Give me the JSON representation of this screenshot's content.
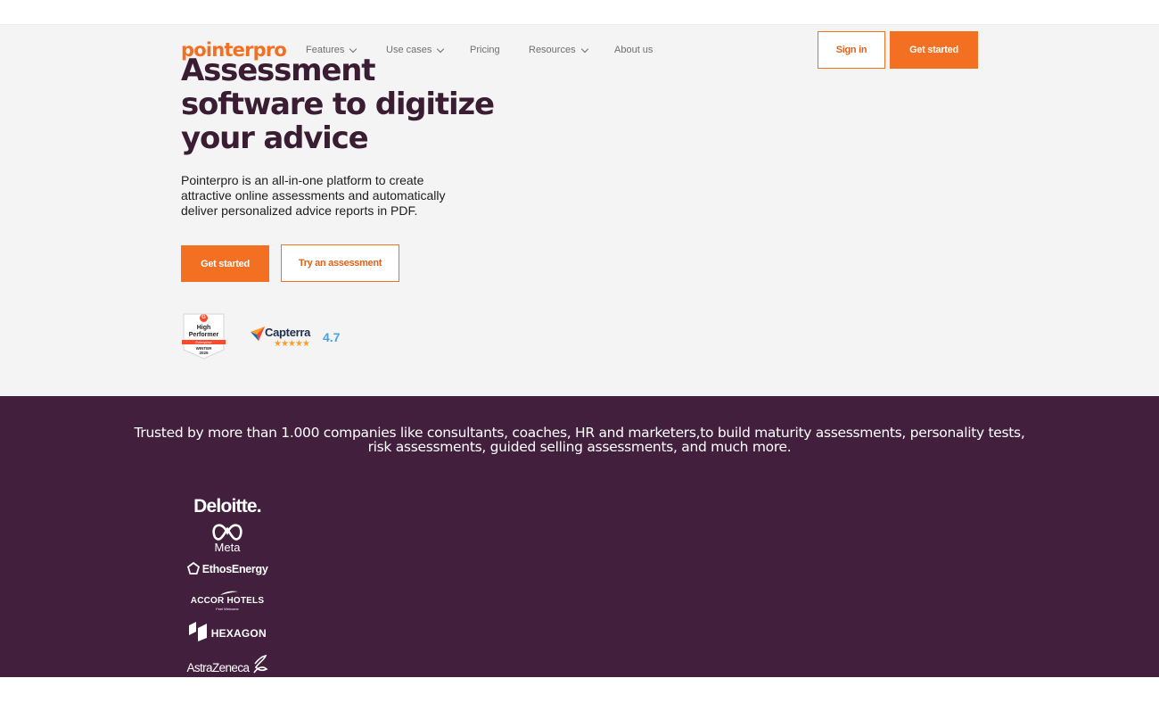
{
  "brand": {
    "name": "pointerpro",
    "primary_color": "#f36f21",
    "dark_color": "#3a1c33",
    "band_color": "#411f3d"
  },
  "nav": {
    "items": [
      {
        "label": "Features",
        "has_dropdown": true
      },
      {
        "label": "Use cases",
        "has_dropdown": true
      },
      {
        "label": "Pricing",
        "has_dropdown": false
      },
      {
        "label": "Resources",
        "has_dropdown": true
      },
      {
        "label": "About us",
        "has_dropdown": false
      }
    ],
    "sign_in_label": "Sign in",
    "get_started_label": "Get started"
  },
  "hero": {
    "title": "Assessment software to digitize your advice",
    "description": "Pointerpro is an all-in-one platform to create attractive online assessments and automatically deliver personalized advice reports in PDF.",
    "primary_cta": "Get started",
    "secondary_cta": "Try an assessment"
  },
  "badges": {
    "g2": {
      "mark": "G",
      "line1": "High",
      "line2": "Performer",
      "band": "Enterprise",
      "season": "WINTER",
      "year": "2025"
    },
    "capterra": {
      "name": "Capterra",
      "stars": "★★★★★",
      "score": "4.7"
    }
  },
  "trust": {
    "text": "Trusted by more than 1.000 companies like consultants, coaches, HR and marketers,to build maturity assessments, personality tests, risk assessments, guided selling assessments, and much more.",
    "logos": {
      "deloitte": "Deloitte.",
      "meta": "Meta",
      "ethos": "EthosEnergy",
      "accor": "ACCOR HOTELS",
      "accor_tagline": "Feel Welcome",
      "hexagon": "HEXAGON",
      "astrazeneca": "AstraZeneca"
    }
  }
}
